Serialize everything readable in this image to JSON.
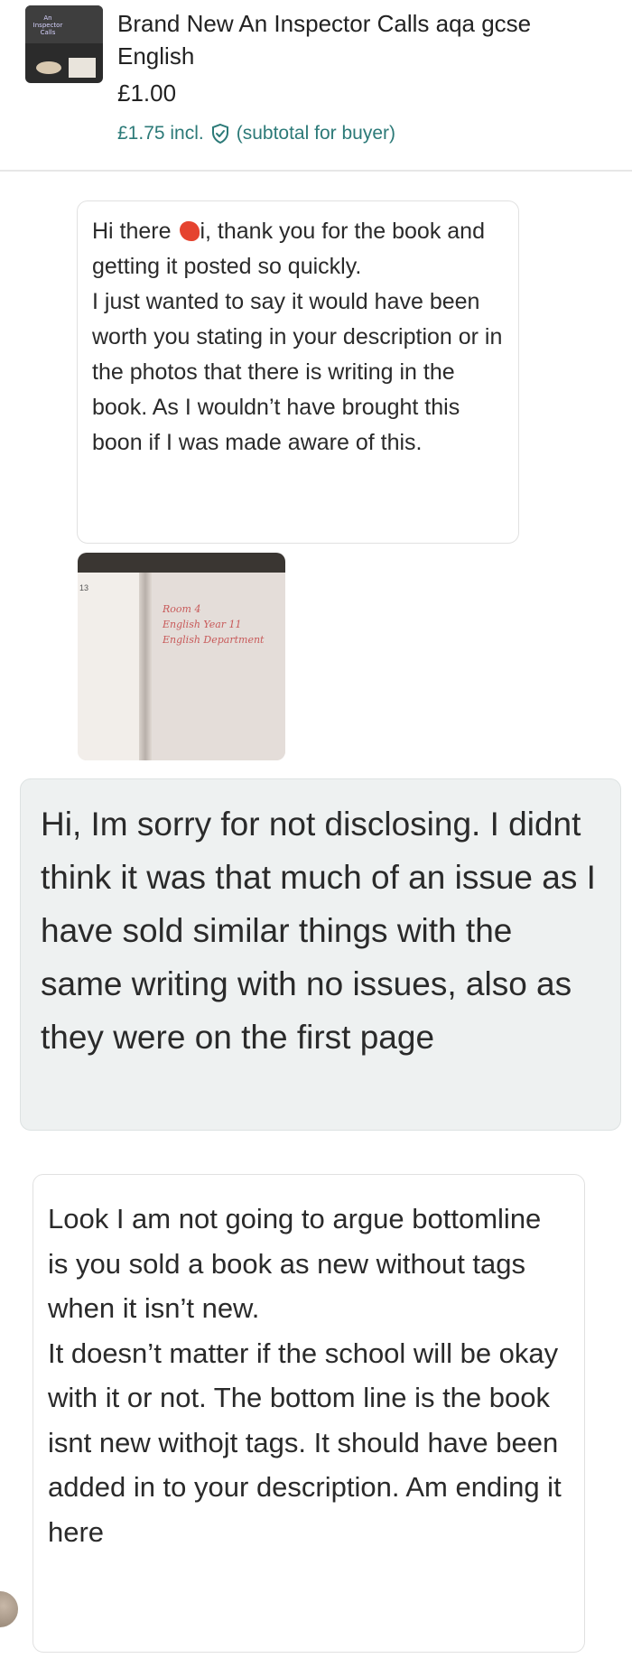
{
  "listing": {
    "title": "Brand New An Inspector Calls aqa gcse English",
    "price": "£1.00",
    "buyer_total": "£1.75 incl.",
    "buyer_total_note": "(subtotal for buyer)",
    "thumbnail_cover_title": "An Inspector Calls"
  },
  "messages": [
    {
      "sender": "buyer",
      "text_before_redaction": "Hi there ",
      "text_after_redaction": "i, thank you for the book and getting it posted so quickly.\nI just wanted to say it would have been worth you stating in your description or in the photos that there is writing in the book. As I wouldn’t have brought this boon if I was made aware of this."
    },
    {
      "sender": "buyer",
      "type": "photo",
      "handwriting_lines": [
        "Room 4",
        "English Year 11",
        "English Department"
      ]
    },
    {
      "sender": "seller",
      "text": "Hi, Im sorry for not disclosing. I didnt think it was that much of an issue as I have sold similar things with the same writing with no issues, also as they were on the first page"
    },
    {
      "sender": "buyer",
      "text": "Look I am not going to argue bottomline is you sold a book as new without tags when it isn’t new.\nIt doesn’t matter if the school will be okay with it or not. The bottom line is the book isnt new withojt tags. It should have been added in to your description. Am ending it here"
    }
  ],
  "colors": {
    "accent_teal": "#2c7a78",
    "seller_bubble_bg": "#eef1f1",
    "redaction": "#e5432f"
  }
}
